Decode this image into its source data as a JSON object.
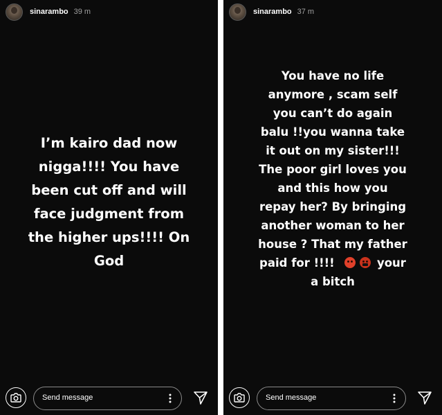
{
  "stories": [
    {
      "username": "sinarambo",
      "time": "39 m",
      "text_lines": [
        "I’m kairo dad now",
        "nigga!!!! You have",
        "been cut off and will",
        "face judgment from",
        "the higher ups!!!! On",
        "God"
      ],
      "message_placeholder": "Send message",
      "icons": [
        "camera-icon",
        "more-vertical-icon",
        "send-icon"
      ]
    },
    {
      "username": "sinarambo",
      "time": "37 m",
      "text_lines": [
        "You have no life",
        "anymore , scam self",
        "you can’t do again",
        "balu !!you wanna take",
        "it out on my sister!!!",
        "The poor girl loves you",
        "and this how you",
        "repay her? By bringing",
        "another woman to her",
        "house ? That my father"
      ],
      "line_with_emoji_before": "paid for !!!!",
      "line_with_emoji_after": "your",
      "last_line": "a bitch",
      "emojis": [
        "angry-face-emoji",
        "face-with-symbols-on-mouth-emoji"
      ],
      "message_placeholder": "Send message",
      "icons": [
        "camera-icon",
        "more-vertical-icon",
        "send-icon"
      ]
    }
  ],
  "colors": {
    "background": "#0b0b0b",
    "text": "#ffffff",
    "timestamp": "#a0a0a0",
    "field_border": "#8a8a8a"
  }
}
